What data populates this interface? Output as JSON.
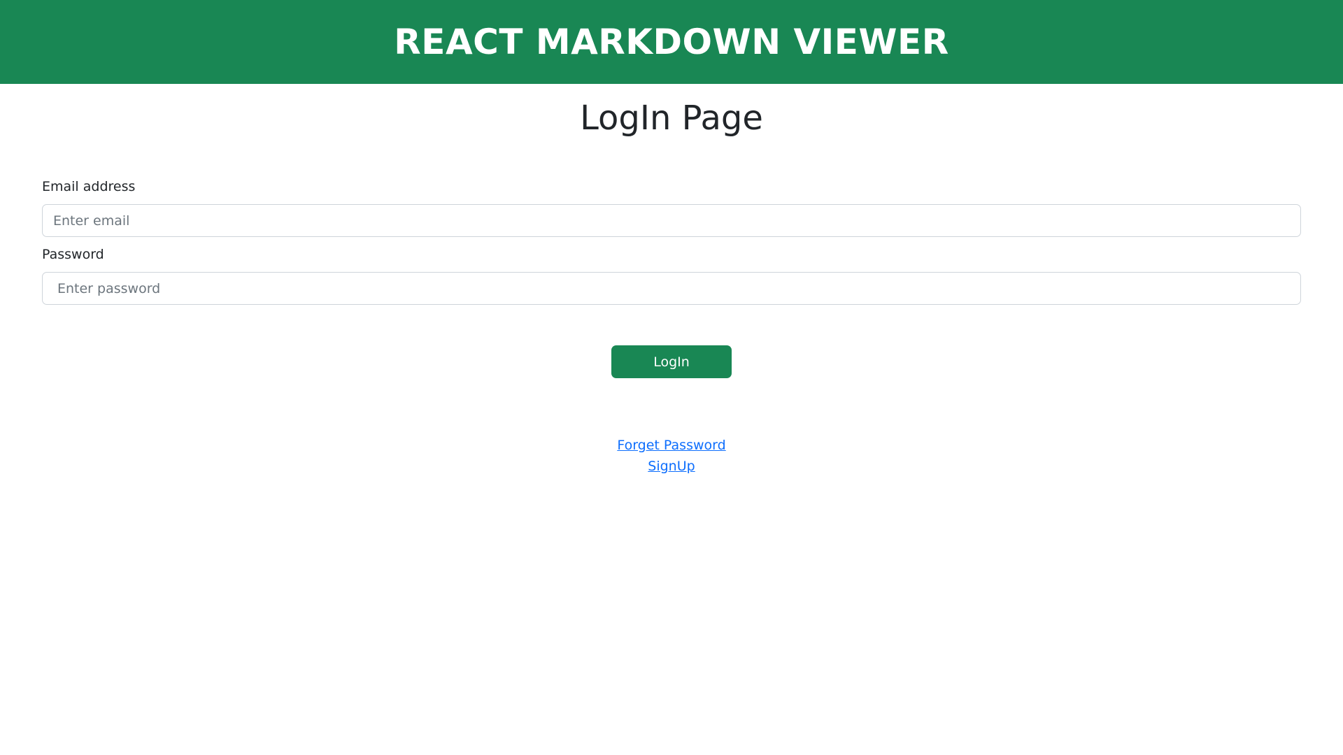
{
  "navbar": {
    "title": "REACT MARKDOWN VIEWER",
    "background_color": "#198754"
  },
  "page": {
    "heading": "LogIn Page"
  },
  "form": {
    "email_label": "Email address",
    "email_value": "",
    "email_placeholder": "Enter email",
    "password_label": "Password",
    "password_value": "",
    "password_placeholder": "Enter password",
    "submit_label": "LogIn"
  },
  "links": {
    "forgot_password": "Forget Password",
    "signup": "SignUp"
  },
  "colors": {
    "primary_green": "#198754",
    "link_blue": "#0d6efd"
  }
}
